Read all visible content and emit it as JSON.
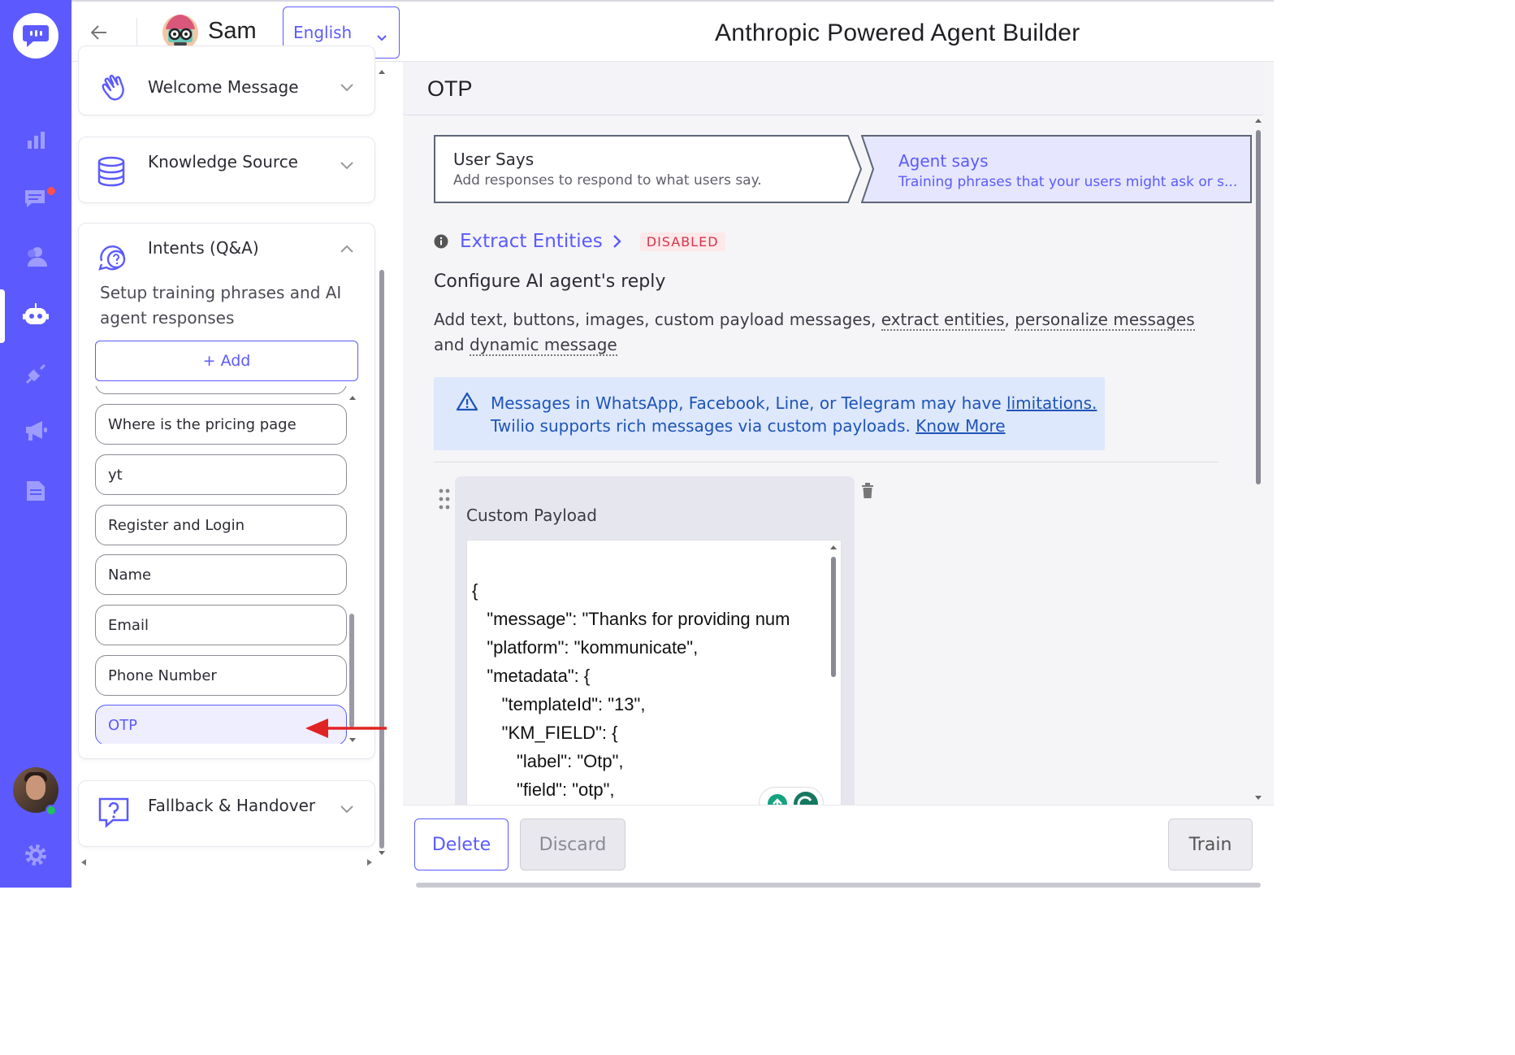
{
  "header": {
    "bot_name": "Sam",
    "language": "English",
    "app_title": "Anthropic Powered Agent Builder"
  },
  "sidebar_nav": {
    "icons": [
      "logo-chat-icon",
      "analytics-icon",
      "conversations-icon",
      "users-icon",
      "bot-icon",
      "integrations-icon",
      "campaigns-icon",
      "reports-icon",
      "settings-icon"
    ],
    "active": "bot-icon",
    "accent": "#5c5aff"
  },
  "sections": {
    "welcome": {
      "title": "Welcome Message"
    },
    "knowledge": {
      "title": "Knowledge Source"
    },
    "intents": {
      "title": "Intents (Q&A)",
      "description": "Setup training phrases and AI agent responses",
      "add_label": "+ Add",
      "items": [
        {
          "label": "Where is the pricing page"
        },
        {
          "label": "yt"
        },
        {
          "label": "Register and Login"
        },
        {
          "label": "Name"
        },
        {
          "label": "Email"
        },
        {
          "label": "Phone Number"
        },
        {
          "label": "OTP"
        }
      ],
      "active_item": "OTP"
    },
    "fallback": {
      "title": "Fallback & Handover"
    }
  },
  "editor": {
    "intent_title": "OTP",
    "steps": [
      {
        "title": "User Says",
        "subtitle": "Add responses to respond to what users say."
      },
      {
        "title": "Agent says",
        "subtitle": "Training phrases that your users might ask or s..."
      }
    ],
    "extract_entities": "Extract Entities",
    "entities_status": "DISABLED",
    "reply_heading": "Configure AI agent's reply",
    "reply_text_start": "Add text, buttons, images, custom payload messages, ",
    "reply_link_1": "extract entities",
    "reply_sep_1": ", ",
    "reply_link_2": "personalize messages",
    "reply_sep_2": " and ",
    "reply_link_3": "dynamic message",
    "notice_line1": "Messages in WhatsApp, Facebook, Line, or Telegram may have ",
    "notice_link1": "limitations.",
    "notice_line2": "Twilio supports rich messages via custom payloads. ",
    "notice_link2": "Know More",
    "payload_label": "Custom Payload",
    "payload_code": "{\n   \"message\": \"Thanks for providing num\n   \"platform\": \"kommunicate\",\n   \"metadata\": {\n      \"templateId\": \"13\",\n      \"KM_FIELD\": {\n         \"label\": \"Otp\",\n         \"field\": \"otp\","
  },
  "footer": {
    "delete_label": "Delete",
    "discard_label": "Discard",
    "train_label": "Train"
  }
}
